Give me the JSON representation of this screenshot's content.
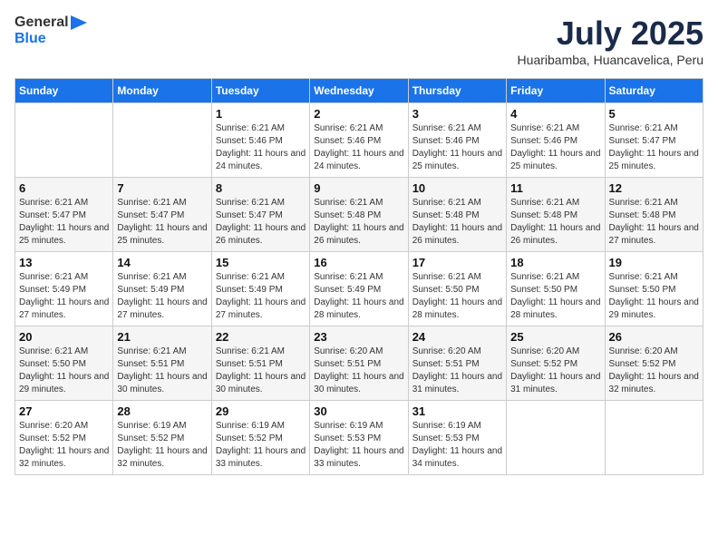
{
  "header": {
    "logo_general": "General",
    "logo_blue": "Blue",
    "month": "July 2025",
    "location": "Huaribamba, Huancavelica, Peru"
  },
  "days_of_week": [
    "Sunday",
    "Monday",
    "Tuesday",
    "Wednesday",
    "Thursday",
    "Friday",
    "Saturday"
  ],
  "weeks": [
    [
      {
        "day": "",
        "info": ""
      },
      {
        "day": "",
        "info": ""
      },
      {
        "day": "1",
        "info": "Sunrise: 6:21 AM\nSunset: 5:46 PM\nDaylight: 11 hours and 24 minutes."
      },
      {
        "day": "2",
        "info": "Sunrise: 6:21 AM\nSunset: 5:46 PM\nDaylight: 11 hours and 24 minutes."
      },
      {
        "day": "3",
        "info": "Sunrise: 6:21 AM\nSunset: 5:46 PM\nDaylight: 11 hours and 25 minutes."
      },
      {
        "day": "4",
        "info": "Sunrise: 6:21 AM\nSunset: 5:46 PM\nDaylight: 11 hours and 25 minutes."
      },
      {
        "day": "5",
        "info": "Sunrise: 6:21 AM\nSunset: 5:47 PM\nDaylight: 11 hours and 25 minutes."
      }
    ],
    [
      {
        "day": "6",
        "info": "Sunrise: 6:21 AM\nSunset: 5:47 PM\nDaylight: 11 hours and 25 minutes."
      },
      {
        "day": "7",
        "info": "Sunrise: 6:21 AM\nSunset: 5:47 PM\nDaylight: 11 hours and 25 minutes."
      },
      {
        "day": "8",
        "info": "Sunrise: 6:21 AM\nSunset: 5:47 PM\nDaylight: 11 hours and 26 minutes."
      },
      {
        "day": "9",
        "info": "Sunrise: 6:21 AM\nSunset: 5:48 PM\nDaylight: 11 hours and 26 minutes."
      },
      {
        "day": "10",
        "info": "Sunrise: 6:21 AM\nSunset: 5:48 PM\nDaylight: 11 hours and 26 minutes."
      },
      {
        "day": "11",
        "info": "Sunrise: 6:21 AM\nSunset: 5:48 PM\nDaylight: 11 hours and 26 minutes."
      },
      {
        "day": "12",
        "info": "Sunrise: 6:21 AM\nSunset: 5:48 PM\nDaylight: 11 hours and 27 minutes."
      }
    ],
    [
      {
        "day": "13",
        "info": "Sunrise: 6:21 AM\nSunset: 5:49 PM\nDaylight: 11 hours and 27 minutes."
      },
      {
        "day": "14",
        "info": "Sunrise: 6:21 AM\nSunset: 5:49 PM\nDaylight: 11 hours and 27 minutes."
      },
      {
        "day": "15",
        "info": "Sunrise: 6:21 AM\nSunset: 5:49 PM\nDaylight: 11 hours and 27 minutes."
      },
      {
        "day": "16",
        "info": "Sunrise: 6:21 AM\nSunset: 5:49 PM\nDaylight: 11 hours and 28 minutes."
      },
      {
        "day": "17",
        "info": "Sunrise: 6:21 AM\nSunset: 5:50 PM\nDaylight: 11 hours and 28 minutes."
      },
      {
        "day": "18",
        "info": "Sunrise: 6:21 AM\nSunset: 5:50 PM\nDaylight: 11 hours and 28 minutes."
      },
      {
        "day": "19",
        "info": "Sunrise: 6:21 AM\nSunset: 5:50 PM\nDaylight: 11 hours and 29 minutes."
      }
    ],
    [
      {
        "day": "20",
        "info": "Sunrise: 6:21 AM\nSunset: 5:50 PM\nDaylight: 11 hours and 29 minutes."
      },
      {
        "day": "21",
        "info": "Sunrise: 6:21 AM\nSunset: 5:51 PM\nDaylight: 11 hours and 30 minutes."
      },
      {
        "day": "22",
        "info": "Sunrise: 6:21 AM\nSunset: 5:51 PM\nDaylight: 11 hours and 30 minutes."
      },
      {
        "day": "23",
        "info": "Sunrise: 6:20 AM\nSunset: 5:51 PM\nDaylight: 11 hours and 30 minutes."
      },
      {
        "day": "24",
        "info": "Sunrise: 6:20 AM\nSunset: 5:51 PM\nDaylight: 11 hours and 31 minutes."
      },
      {
        "day": "25",
        "info": "Sunrise: 6:20 AM\nSunset: 5:52 PM\nDaylight: 11 hours and 31 minutes."
      },
      {
        "day": "26",
        "info": "Sunrise: 6:20 AM\nSunset: 5:52 PM\nDaylight: 11 hours and 32 minutes."
      }
    ],
    [
      {
        "day": "27",
        "info": "Sunrise: 6:20 AM\nSunset: 5:52 PM\nDaylight: 11 hours and 32 minutes."
      },
      {
        "day": "28",
        "info": "Sunrise: 6:19 AM\nSunset: 5:52 PM\nDaylight: 11 hours and 32 minutes."
      },
      {
        "day": "29",
        "info": "Sunrise: 6:19 AM\nSunset: 5:52 PM\nDaylight: 11 hours and 33 minutes."
      },
      {
        "day": "30",
        "info": "Sunrise: 6:19 AM\nSunset: 5:53 PM\nDaylight: 11 hours and 33 minutes."
      },
      {
        "day": "31",
        "info": "Sunrise: 6:19 AM\nSunset: 5:53 PM\nDaylight: 11 hours and 34 minutes."
      },
      {
        "day": "",
        "info": ""
      },
      {
        "day": "",
        "info": ""
      }
    ]
  ]
}
